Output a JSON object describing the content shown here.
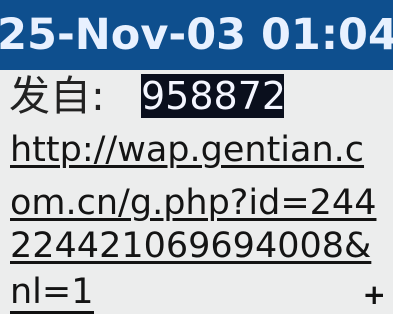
{
  "status_bar": {
    "datetime": "25-Nov-03 01:04"
  },
  "message": {
    "sender_label": "发自:",
    "sender_number": "958872",
    "lines": [
      "http://wap.gentian.c",
      "om.cn/g.php?id=244",
      "22442106969400​8&",
      "nl=1"
    ]
  },
  "scroll": {
    "indicator": "+"
  }
}
